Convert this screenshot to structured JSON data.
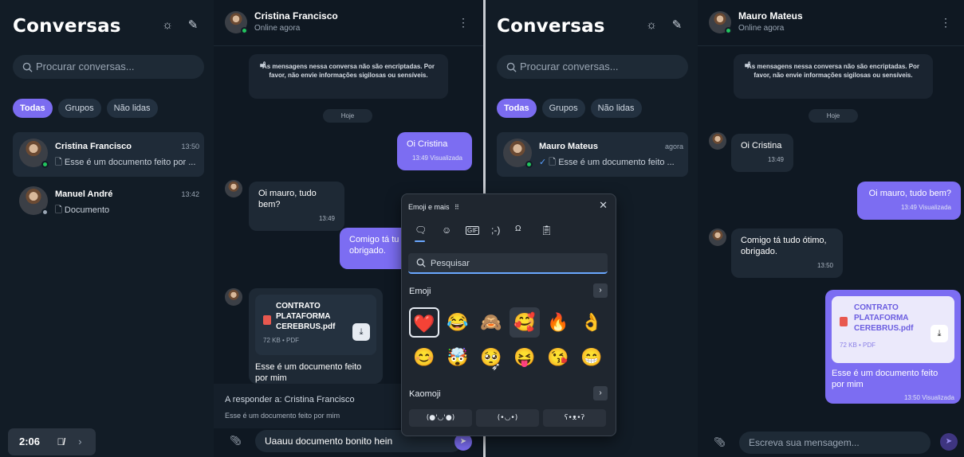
{
  "left": {
    "sidebar": {
      "title": "Conversas",
      "search_placeholder": "Procurar conversas...",
      "filters": [
        "Todas",
        "Grupos",
        "Não lidas"
      ],
      "conversations": [
        {
          "name": "Cristina Francisco",
          "time": "13:50",
          "preview": "Esse é um documento feito por ...",
          "status_color": "#22c55e"
        },
        {
          "name": "Manuel André",
          "time": "13:42",
          "preview": "Documento",
          "status_color": "#9aa6b4"
        }
      ]
    },
    "chat": {
      "contact": "Cristina Francisco",
      "status": "Online agora",
      "notice": "As mensagens nessa conversa não são encriptadas. Por favor, não envie informações sigilosas ou sensíveis.",
      "day": "Hoje",
      "msg_out_1": {
        "text": "Oi Cristina",
        "meta": "13:49 Visualizada"
      },
      "msg_in_1": {
        "text": "Oi mauro, tudo bem?",
        "meta": "13:49"
      },
      "msg_out_2": {
        "text": "Comigo tá tu",
        "text2": "obrigado."
      },
      "file": {
        "name": "CONTRATO PLATAFORMA CEREBRUS.pdf",
        "meta": "72 KB • PDF",
        "caption": "Esse é um documento feito por mim"
      },
      "reply_label": "A responder a: Cristina Francisco",
      "reply_text": "Esse é um documento feito por mim",
      "input_value": "Uaauu documento bonito hein"
    }
  },
  "right": {
    "sidebar": {
      "title": "Conversas",
      "search_placeholder": "Procurar conversas...",
      "filters": [
        "Todas",
        "Grupos",
        "Não lidas"
      ],
      "conversations": [
        {
          "name": "Mauro Mateus",
          "time": "agora",
          "preview": "Esse é um documento feito ...",
          "status_color": "#22c55e"
        }
      ]
    },
    "chat": {
      "contact": "Mauro Mateus",
      "status": "Online agora",
      "notice": "As mensagens nessa conversa não são encriptadas. Por favor, não envie informações sigilosas ou sensíveis.",
      "day": "Hoje",
      "msg_in_1": {
        "text": "Oi Cristina",
        "meta": "13:49"
      },
      "msg_out_1": {
        "text": "Oi mauro, tudo bem?",
        "meta": "13:49 Visualizada"
      },
      "msg_in_2": {
        "text": "Comigo tá tudo ótimo, obrigado.",
        "meta": "13:50"
      },
      "file": {
        "name": "CONTRATO PLATAFORMA CEREBRUS.pdf",
        "meta": "72 KB • PDF",
        "caption": "Esse é um documento feito por mim",
        "time": "13:50 Visualizada"
      },
      "input_placeholder": "Escreva sua mensagem..."
    }
  },
  "emoji_panel": {
    "title": "Emoji e mais",
    "tabs": [
      "emoji-tab",
      "smiley-tab",
      "gif-tab",
      ";-)",
      "symbols-tab",
      "clipboard-tab"
    ],
    "search_placeholder": "Pesquisar",
    "emoji_label": "Emoji",
    "emojis": [
      "❤️",
      "😂",
      "🙈",
      "🥰",
      "🔥",
      "👌",
      "😊",
      "🤯",
      "🥺",
      "😝",
      "😘",
      "😁"
    ],
    "kaomoji_label": "Kaomoji",
    "kaomojis": [
      "(●'◡'●)",
      "(•◡•)",
      "ʕ•ᴥ•ʔ"
    ]
  },
  "recorder": {
    "time": "2:06"
  },
  "colors": {
    "accent": "#7c6df2",
    "bg": "#0f1822",
    "online": "#22c55e"
  }
}
